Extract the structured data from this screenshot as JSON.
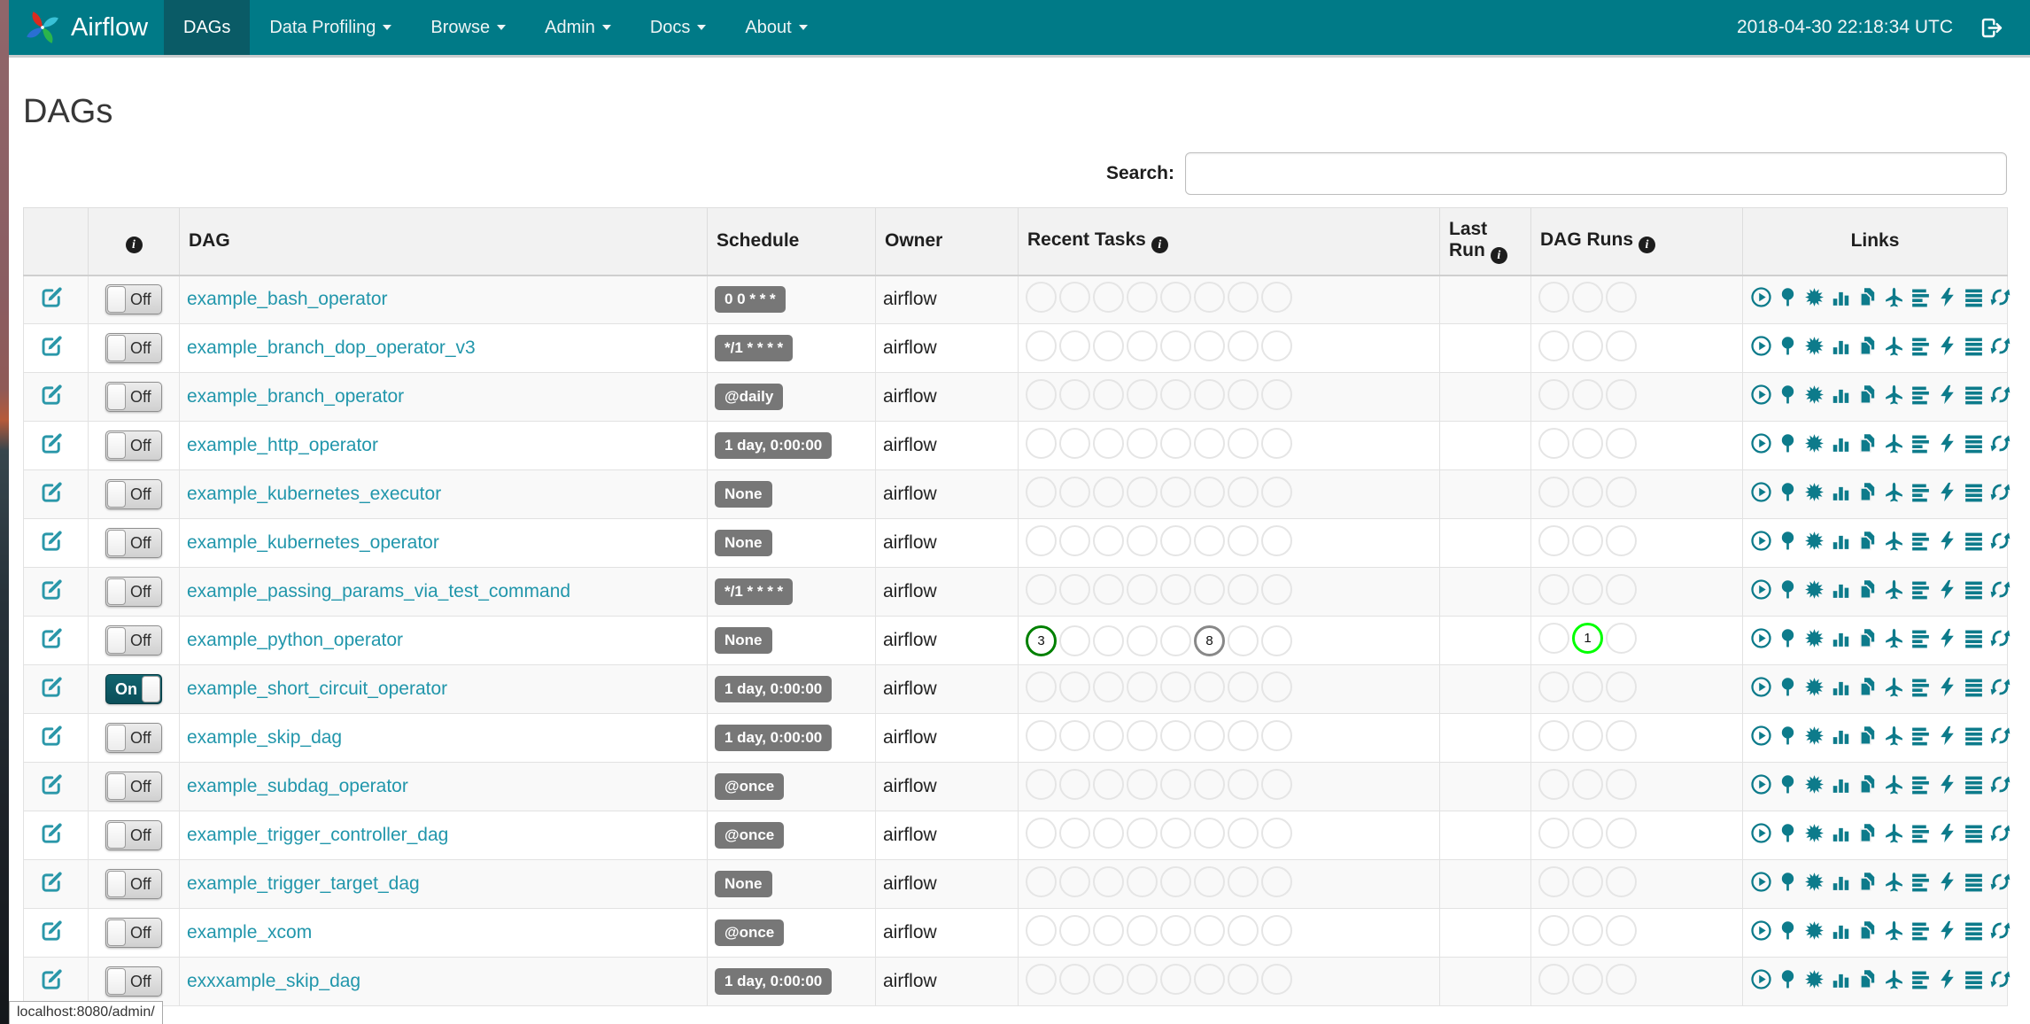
{
  "navbar": {
    "brand": "Airflow",
    "items": [
      {
        "label": "DAGs",
        "active": true,
        "caret": false
      },
      {
        "label": "Data Profiling",
        "active": false,
        "caret": true
      },
      {
        "label": "Browse",
        "active": false,
        "caret": true
      },
      {
        "label": "Admin",
        "active": false,
        "caret": true
      },
      {
        "label": "Docs",
        "active": false,
        "caret": true
      },
      {
        "label": "About",
        "active": false,
        "caret": true
      }
    ],
    "clock": "2018-04-30 22:18:34 UTC"
  },
  "page": {
    "title": "DAGs",
    "search_label": "Search:",
    "search_value": "",
    "status_bar": "localhost:8080/admin/"
  },
  "icons": {
    "info_glyph": "i"
  },
  "table": {
    "headers": {
      "dag": "DAG",
      "schedule": "Schedule",
      "owner": "Owner",
      "recent_tasks": "Recent Tasks",
      "last_run": "Last Run",
      "dag_runs": "DAG Runs",
      "links": "Links"
    },
    "recent_task_slots": 8,
    "dag_run_slots": 3,
    "rows": [
      {
        "name": "example_bash_operator",
        "toggle": "Off",
        "schedule": "0 0 * * *",
        "owner": "airflow",
        "last_run": "",
        "recent_tasks": [],
        "dag_runs": []
      },
      {
        "name": "example_branch_dop_operator_v3",
        "toggle": "Off",
        "schedule": "*/1 * * * *",
        "owner": "airflow",
        "last_run": "",
        "recent_tasks": [],
        "dag_runs": []
      },
      {
        "name": "example_branch_operator",
        "toggle": "Off",
        "schedule": "@daily",
        "owner": "airflow",
        "last_run": "",
        "recent_tasks": [],
        "dag_runs": []
      },
      {
        "name": "example_http_operator",
        "toggle": "Off",
        "schedule": "1 day, 0:00:00",
        "owner": "airflow",
        "last_run": "",
        "recent_tasks": [],
        "dag_runs": []
      },
      {
        "name": "example_kubernetes_executor",
        "toggle": "Off",
        "schedule": "None",
        "owner": "airflow",
        "last_run": "",
        "recent_tasks": [],
        "dag_runs": []
      },
      {
        "name": "example_kubernetes_operator",
        "toggle": "Off",
        "schedule": "None",
        "owner": "airflow",
        "last_run": "",
        "recent_tasks": [],
        "dag_runs": []
      },
      {
        "name": "example_passing_params_via_test_command",
        "toggle": "Off",
        "schedule": "*/1 * * * *",
        "owner": "airflow",
        "last_run": "",
        "recent_tasks": [],
        "dag_runs": []
      },
      {
        "name": "example_python_operator",
        "toggle": "Off",
        "schedule": "None",
        "owner": "airflow",
        "last_run": "",
        "recent_tasks": [
          {
            "slot": 1,
            "count": "3",
            "state": "success"
          },
          {
            "slot": 6,
            "count": "8",
            "state": "no_status"
          }
        ],
        "dag_runs": [
          {
            "slot": 2,
            "count": "1",
            "state": "running"
          }
        ]
      },
      {
        "name": "example_short_circuit_operator",
        "toggle": "On",
        "schedule": "1 day, 0:00:00",
        "owner": "airflow",
        "last_run": "",
        "recent_tasks": [],
        "dag_runs": []
      },
      {
        "name": "example_skip_dag",
        "toggle": "Off",
        "schedule": "1 day, 0:00:00",
        "owner": "airflow",
        "last_run": "",
        "recent_tasks": [],
        "dag_runs": []
      },
      {
        "name": "example_subdag_operator",
        "toggle": "Off",
        "schedule": "@once",
        "owner": "airflow",
        "last_run": "",
        "recent_tasks": [],
        "dag_runs": []
      },
      {
        "name": "example_trigger_controller_dag",
        "toggle": "Off",
        "schedule": "@once",
        "owner": "airflow",
        "last_run": "",
        "recent_tasks": [],
        "dag_runs": []
      },
      {
        "name": "example_trigger_target_dag",
        "toggle": "Off",
        "schedule": "None",
        "owner": "airflow",
        "last_run": "",
        "recent_tasks": [],
        "dag_runs": []
      },
      {
        "name": "example_xcom",
        "toggle": "Off",
        "schedule": "@once",
        "owner": "airflow",
        "last_run": "",
        "recent_tasks": [],
        "dag_runs": []
      },
      {
        "name": "exxxample_skip_dag",
        "toggle": "Off",
        "schedule": "1 day, 0:00:00",
        "owner": "airflow",
        "last_run": "",
        "recent_tasks": [],
        "dag_runs": []
      }
    ],
    "link_icons": [
      "play-circle-icon",
      "tree-icon",
      "sunburst-icon",
      "bar-chart-icon",
      "copy-icon",
      "plane-icon",
      "gantt-icon",
      "lightning-icon",
      "list-icon",
      "refresh-icon"
    ]
  },
  "colors": {
    "navbar": "#007a87",
    "navbar_active": "#0a5b66",
    "dag_link": "#2196ab",
    "link_icon": "#0d7b8b",
    "schedule_badge": "#777777",
    "state_success": "#008000",
    "state_running": "#00ff00",
    "state_no_status": "#888888"
  }
}
